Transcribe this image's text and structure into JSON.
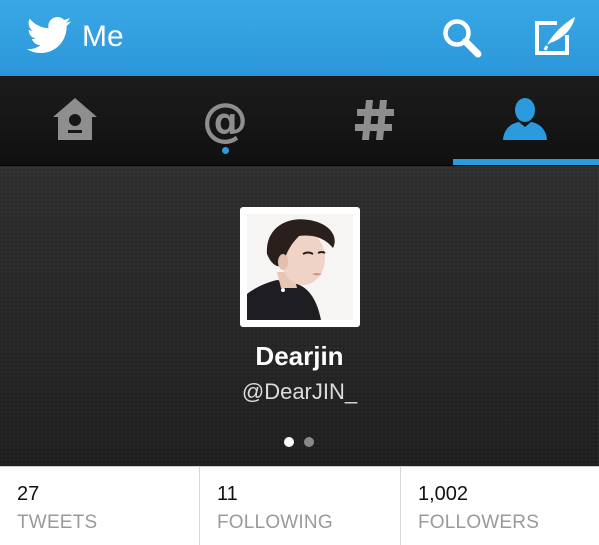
{
  "app_bar": {
    "title": "Me",
    "logo_icon": "twitter-bird-icon",
    "actions": [
      "search-icon",
      "compose-icon"
    ]
  },
  "tabs": [
    {
      "id": "home",
      "icon": "home-birdhouse-icon",
      "selected": false
    },
    {
      "id": "mentions",
      "icon": "at-icon",
      "selected": false,
      "has_unread_dot": true
    },
    {
      "id": "discover",
      "icon": "hashtag-icon",
      "selected": false
    },
    {
      "id": "me",
      "icon": "person-icon",
      "selected": true
    }
  ],
  "profile": {
    "display_name": "Dearjin",
    "handle": "@DearJIN_",
    "pager": {
      "pages": 2,
      "current": 1
    }
  },
  "stats": [
    {
      "count": "27",
      "label": "TWEETS"
    },
    {
      "count": "11",
      "label": "FOLLOWING"
    },
    {
      "count": "1,002",
      "label": "FOLLOWERS"
    }
  ],
  "colors": {
    "action_bar": "#2b97d9",
    "accent": "#2b9be0",
    "tab_bar": "#141414",
    "tab_icon": "#8e8e8e"
  }
}
